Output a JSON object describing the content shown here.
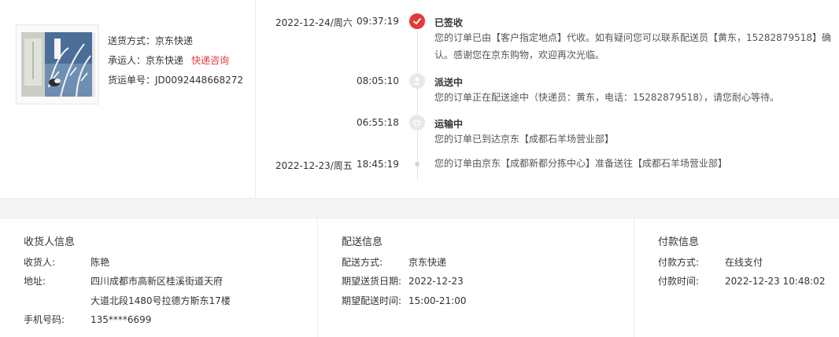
{
  "shipment": {
    "method_label": "送货方式：",
    "method_value": "京东快递",
    "carrier_label": "承运人：",
    "carrier_value": "京东快递",
    "carrier_link": "快递咨询",
    "tracking_label": "货运单号：",
    "tracking_value": "JD0092448668272"
  },
  "timeline": [
    {
      "date": "2022-12-24/周六",
      "time": "09:37:19",
      "title": "已签收",
      "text": "您的订单已由【客户指定地点】代收。如有疑问您可以联系配送员【黄东，15282879518】确认。感谢您在京东购物，欢迎再次光临。",
      "icon": "check-icon",
      "status_color": "#e4393c"
    },
    {
      "date": "",
      "time": "08:05:10",
      "title": "派送中",
      "text": "您的订单正在配送途中（快递员：黄东，电话：15282879518），请您耐心等待。",
      "icon": "courier-icon"
    },
    {
      "date": "",
      "time": "06:55:18",
      "title": "运输中",
      "text": "您的订单已到达京东【成都石羊场营业部】",
      "icon": "transit-icon"
    },
    {
      "date": "2022-12-23/周五",
      "time": "18:45:19",
      "title": "",
      "text": "您的订单由京东【成都新都分拣中心】准备送往【成都石羊场营业部】",
      "icon": "dot-icon"
    }
  ],
  "receiver": {
    "heading": "收货人信息",
    "name_label": "收货人:",
    "name_value": "陈艳",
    "address_label": "地址:",
    "address_line1": "四川成都市高新区桂溪街道天府",
    "address_line2": "大道北段1480号拉德方斯东17楼",
    "phone_label": "手机号码:",
    "phone_value": "135****6699"
  },
  "delivery": {
    "heading": "配送信息",
    "method_label": "配送方式:",
    "method_value": "京东快递",
    "date_label": "期望送货日期:",
    "date_value": "2022-12-23",
    "time_label": "期望配送时间:",
    "time_value": "15:00-21:00"
  },
  "payment": {
    "heading": "付款信息",
    "method_label": "付款方式:",
    "method_value": "在线支付",
    "time_label": "付款时间:",
    "time_value": "2022-12-23 10:48:02"
  }
}
